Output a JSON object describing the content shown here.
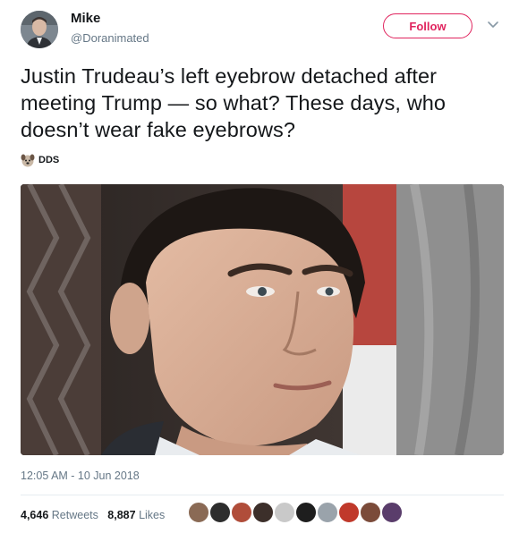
{
  "author": {
    "name": "Mike",
    "handle": "@Doranimated",
    "follow_label": "Follow"
  },
  "tweet": {
    "text": "Justin Trudeau’s left eyebrow detached after meeting Trump — so what? These days, who doesn’t wear fake eyebrows?",
    "watermark": "DDS",
    "timestamp": "12:05 AM - 10 Jun 2018"
  },
  "stats": {
    "retweets_count": "4,646",
    "retweets_label": "Retweets",
    "likes_count": "8,887",
    "likes_label": "Likes"
  },
  "likers": [
    "#8a6a55",
    "#2d2d2d",
    "#b04d3a",
    "#3c2f2a",
    "#c9c9c9",
    "#1e1e1e",
    "#9aa3ab",
    "#c0392b",
    "#7b4b3a",
    "#5a3d6b"
  ],
  "colors": {
    "accent": "#e0245e",
    "text": "#14171a",
    "secondary": "#657786"
  }
}
